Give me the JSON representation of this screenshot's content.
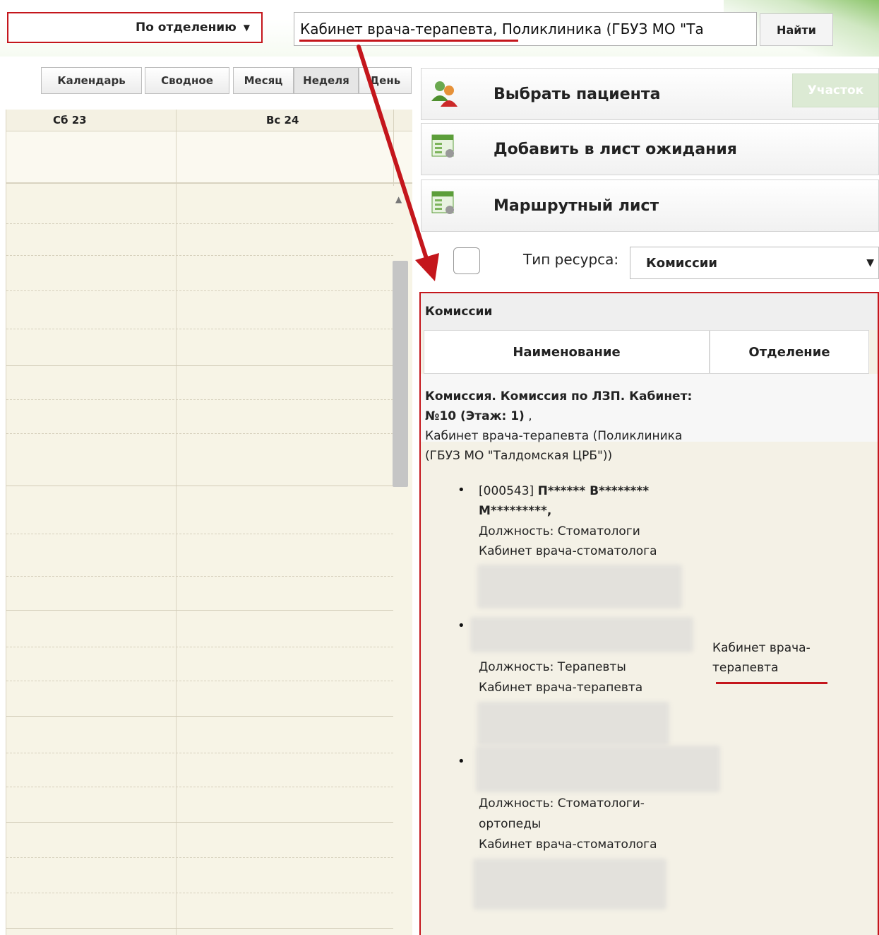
{
  "header": {
    "department_select": "По отделению",
    "search_value": "Кабинет врача-терапевта, Поликлиника (ГБУЗ МО \"Та",
    "find_button": "Найти"
  },
  "view_buttons": [
    "Календарь",
    "Сводное",
    "Месяц",
    "Неделя",
    "День"
  ],
  "calendar": {
    "days": [
      "Сб 23",
      "Вс 24"
    ]
  },
  "actions": {
    "select_patient": "Выбрать пациента",
    "uchastok": "Участок",
    "add_waiting": "Добавить в лист ожидания",
    "route_sheet": "Маршрутный лист"
  },
  "resource": {
    "label": "Тип ресурса:",
    "value": "Комиссии"
  },
  "panel": {
    "title": "Комиссии",
    "col_name": "Наименование",
    "col_dept": "Отделение",
    "commission_line1": "Комиссия. Комиссия по ЛЗП. Кабинет:",
    "commission_line2": "№10 (Этаж: 1)",
    "commission_line2_suffix": " ,",
    "commission_place1": "Кабинет врача-терапевта (Поликлиника",
    "commission_place2": "(ГБУЗ МО \"Талдомская ЦРБ\"))",
    "members": [
      {
        "code": "[000543]",
        "name1": "П****** В********",
        "name2": "М*********,",
        "position": "Должность: Стоматологи",
        "cabinet": "Кабинет врача-стоматолога"
      },
      {
        "position": "Должность: Терапевты",
        "cabinet": "Кабинет врача-терапевта",
        "dept1": "Кабинет врача-",
        "dept2": "терапевта"
      },
      {
        "position1": "Должность: Стоматологи-",
        "position2": "ортопеды",
        "cabinet": "Кабинет врача-стоматолога"
      }
    ]
  },
  "colors": {
    "accent_red": "#c4161c",
    "calendar_bg": "#f7f4e6",
    "header_green": "#8cc56b"
  }
}
